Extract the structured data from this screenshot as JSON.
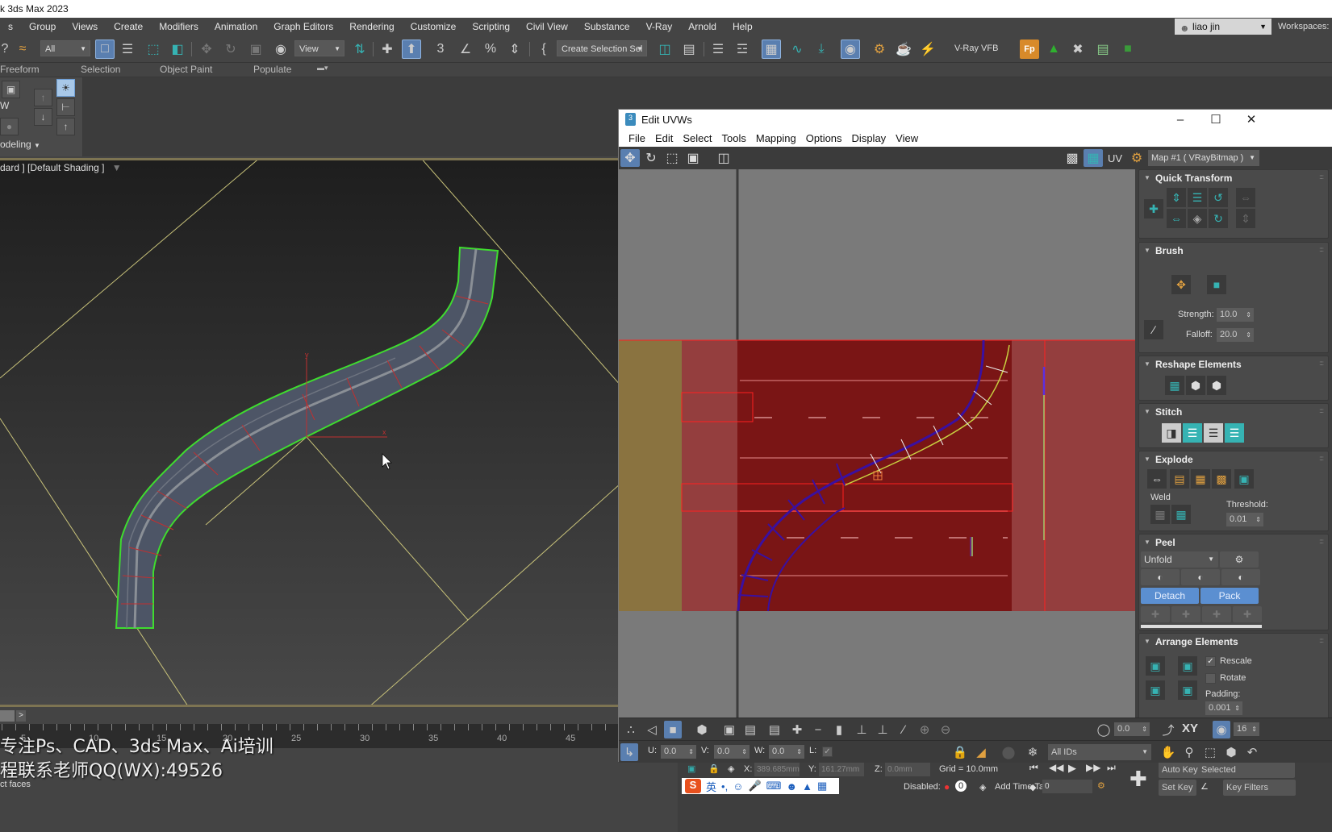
{
  "app": {
    "title": "k 3ds Max 2023"
  },
  "menubar": {
    "items": [
      "s",
      "Group",
      "Views",
      "Create",
      "Modifiers",
      "Animation",
      "Graph Editors",
      "Rendering",
      "Customize",
      "Scripting",
      "Civil View",
      "Substance",
      "V-Ray",
      "Arnold",
      "Help"
    ]
  },
  "user": {
    "name": "liao jin",
    "workspaces_label": "Workspaces:"
  },
  "main_toolbar": {
    "selection_filter": "All",
    "reference_coord": "View",
    "named_selection": "Create Selection Sel",
    "vray_vfb_label": "V-Ray VFB"
  },
  "ribbon": {
    "tabs": [
      "Freeform",
      "Selection",
      "Object Paint",
      "Populate"
    ],
    "panel_label": "odeling"
  },
  "viewport": {
    "label": "dard ] [Default Shading ]",
    "axis_x": "x",
    "axis_y": "y"
  },
  "timeline": {
    "next_label": ">",
    "ticks": [
      "5",
      "10",
      "15",
      "20",
      "25",
      "30",
      "35",
      "40",
      "45"
    ]
  },
  "watermark": {
    "line1": "专注Ps、CAD、3ds Max、Ai培训",
    "line2": "程联系老师QQ(WX):49526"
  },
  "status": {
    "prompt": "ct faces",
    "x_label": "X:",
    "x_value": "389.685mm",
    "y_label": "Y:",
    "y_value": "161.27mm",
    "z_label": "Z:",
    "z_value": "0.0mm",
    "grid": "Grid = 10.0mm",
    "disabled_label": "Disabled:",
    "disabled_count": "0",
    "add_time_tag": "Add Time Tag",
    "frame_value": "0",
    "auto_key": "Auto Key",
    "set_key": "Set Key",
    "selected_option": "Selected",
    "key_filters": "Key Filters"
  },
  "uvw_window": {
    "title": "Edit UVWs",
    "app_icon": "3",
    "menu": [
      "File",
      "Edit",
      "Select",
      "Tools",
      "Mapping",
      "Options",
      "Display",
      "View"
    ],
    "uv_label": "UV",
    "map_select": "Map #1 ( VRayBitmap )",
    "panel": {
      "quick_transform": "Quick Transform",
      "brush": "Brush",
      "strength_label": "Strength:",
      "strength_value": "10.0",
      "falloff_label": "Falloff:",
      "falloff_value": "20.0",
      "reshape_elements": "Reshape Elements",
      "stitch": "Stitch",
      "explode": "Explode",
      "weld_label": "Weld",
      "threshold_label": "Threshold:",
      "threshold_value": "0.01",
      "peel": "Peel",
      "peel_mode": "Unfold",
      "detach": "Detach",
      "pack": "Pack",
      "arrange_elements": "Arrange Elements",
      "rescale_label": "Rescale",
      "rescale_checked": true,
      "rotate_label": "Rotate",
      "rotate_checked": false,
      "padding_label": "Padding:",
      "padding_value": "0.001"
    },
    "bottom": {
      "soft_value": "0.0",
      "xy_label": "XY",
      "grid_value": "16",
      "u_label": "U:",
      "u_value": "0.0",
      "v_label": "V:",
      "v_value": "0.0",
      "w_label": "W:",
      "w_value": "0.0",
      "l_label": "L:",
      "ids_select": "All IDs"
    }
  },
  "colors": {
    "selection_green": "#3fdc2f",
    "uv_texture_red": "#7a1515",
    "accent_blue": "#5b8fd1",
    "teal_icon": "#36b3b3"
  }
}
